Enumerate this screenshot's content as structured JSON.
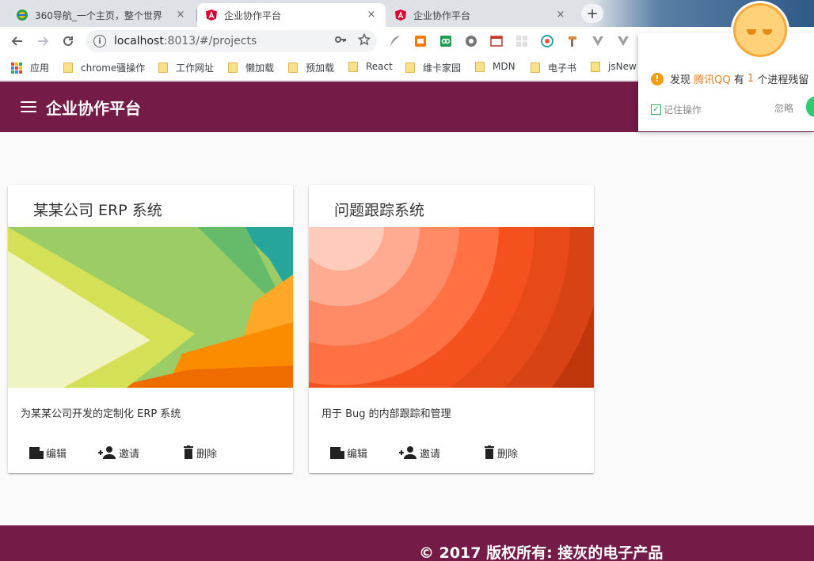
{
  "browser": {
    "tabs": [
      {
        "title": "360导航_一个主页，整个世界",
        "close": "×"
      },
      {
        "title": "企业协作平台",
        "close": "×"
      },
      {
        "title": "企业协作平台",
        "close": "×"
      }
    ],
    "new_tab": "+",
    "url": {
      "host": "localhost",
      "rest": ":8013/#/projects"
    },
    "bookmarks": [
      "应用",
      "chrome骚操作",
      "工作网址",
      "懒加载",
      "预加载",
      "React",
      "维卡家园",
      "MDN",
      "电子书",
      "jsNew"
    ]
  },
  "app": {
    "title": "企业协作平台"
  },
  "projects": [
    {
      "name": "某某公司 ERP 系统",
      "description": "为某某公司开发的定制化 ERP 系统",
      "actions": {
        "edit": "编辑",
        "invite": "邀请",
        "delete": "删除"
      }
    },
    {
      "name": "问题跟踪系统",
      "description": "用于 Bug 的内部跟踪和管理",
      "actions": {
        "edit": "编辑",
        "invite": "邀请",
        "delete": "删除"
      }
    }
  ],
  "footer": {
    "text": "© 2017 版权所有: 接灰的电子产品"
  },
  "popup": {
    "msg_prefix": "发现",
    "app_name": "腾讯QQ",
    "msg_mid": "有",
    "count": "1",
    "msg_suffix": "个进程残留",
    "remember": "记住操作",
    "ignore": "忽略"
  },
  "colors": {
    "primary": "#751b48",
    "accent_orange": "#e67e22",
    "success": "#2ecc71"
  }
}
